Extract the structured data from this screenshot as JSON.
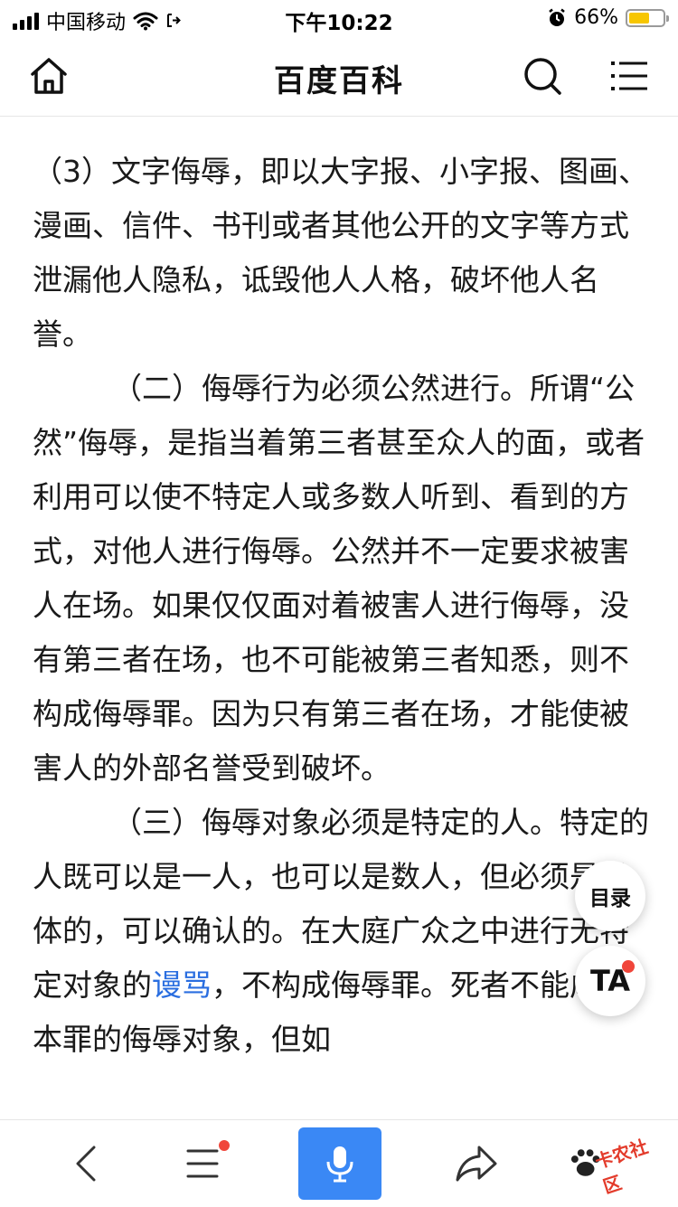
{
  "status_bar": {
    "carrier": "中国移动",
    "time": "下午10:22",
    "battery_percent": "66%",
    "battery_level": 0.66,
    "icons": [
      "signal-icon",
      "wifi-icon",
      "location-arrow-icon",
      "alarm-icon",
      "battery-icon"
    ]
  },
  "header": {
    "title": "百度百科",
    "icons": [
      "home-icon",
      "search-icon",
      "menu-icon"
    ]
  },
  "article": {
    "paragraphs": [
      {
        "parts": [
          {
            "text": "（3）文字侮辱，即以大字报、小字报、图画、漫画、信件、书刊或者其他公开的文字等方式泄漏他人隐私，诋毁他人人格，破坏他人名誉。"
          }
        ]
      },
      {
        "parts": [
          {
            "text": "（二）侮辱行为必须公然进行。所谓“公然”侮辱，是指当着第三者甚至众人的面，或者利用可以使不特定人或多数人听到、看到的方式，对他人进行侮辱。公然并不一定要求被害人在场。如果仅仅面对着被害人进行侮辱，没有第三者在场，也不可能被第三者知悉，则不构成侮辱罪。因为只有第三者在场，才能使被害人的外部名誉受到破坏。"
          }
        ]
      },
      {
        "parts": [
          {
            "text": "（三）侮辱对象必须是特定的人。特定的人既可以是一人，也可以是数人，但必须是具体的，可以确认的。在大庭广众之中进行无特定对象的"
          },
          {
            "text": "谩骂",
            "link": true
          },
          {
            "text": "，不构成侮辱罪。死者不能成为本罪的侮辱对象，但如"
          }
        ]
      }
    ]
  },
  "floating": {
    "toc_label": "目录",
    "ta_label": "TA"
  },
  "bottom_bar": {
    "icons": [
      "back-icon",
      "list-menu-icon",
      "microphone-icon",
      "share-icon"
    ],
    "mic_color": "#3a88f5",
    "watermark": "卡农社区"
  },
  "colors": {
    "link": "#2a6ee0",
    "accent_red": "#f0453a",
    "battery": "#f7c600"
  }
}
